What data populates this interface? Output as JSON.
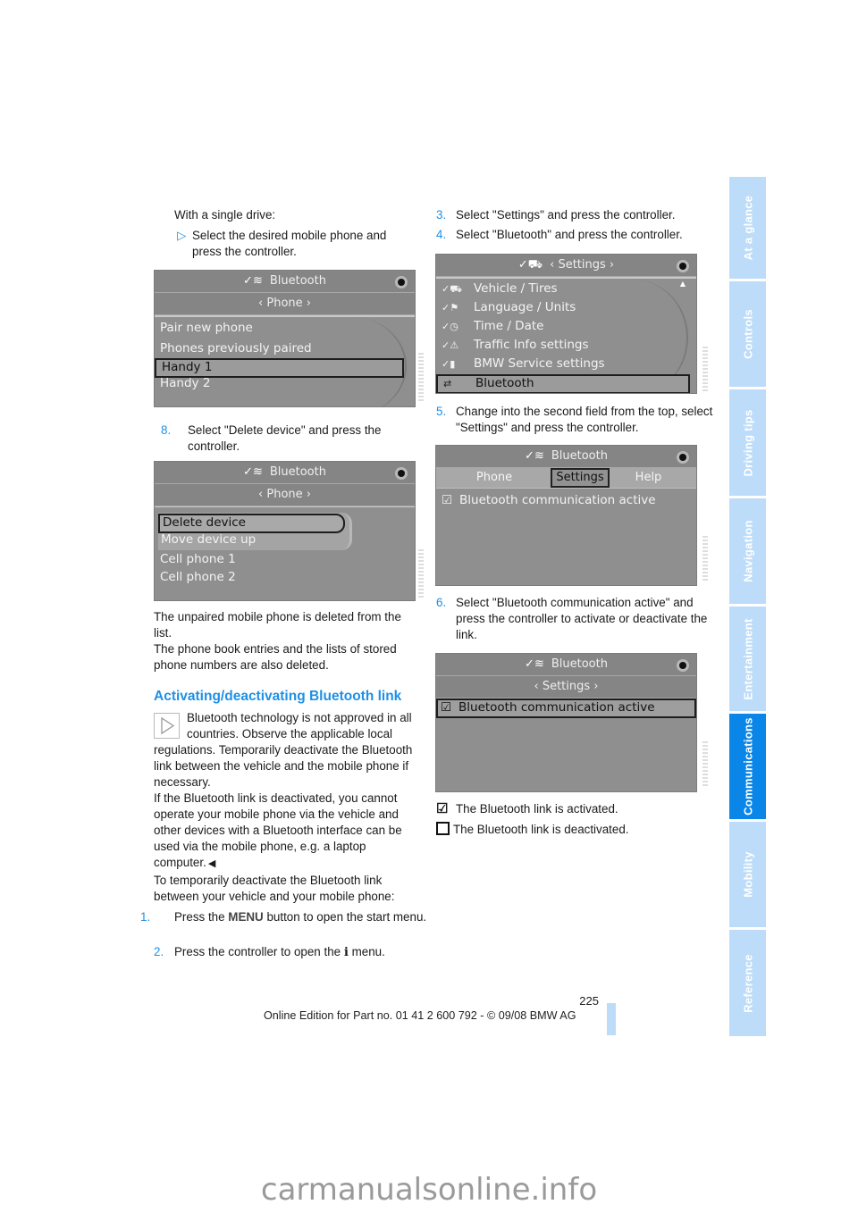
{
  "page_number": "225",
  "footer": "Online Edition for Part no. 01 41 2 600 792 - © 09/08 BMW AG",
  "watermark": "carmanualsonline.info",
  "colors": {
    "accent": "#1e90e6",
    "sidebar": "#bcdcf9",
    "sidebar_active": "#0a86e8",
    "screen_bg": "#8f8f8f"
  },
  "sidebar": {
    "tabs": [
      {
        "label": "At a glance",
        "active": false
      },
      {
        "label": "Controls",
        "active": false
      },
      {
        "label": "Driving tips",
        "active": false
      },
      {
        "label": "Navigation",
        "active": false
      },
      {
        "label": "Entertainment",
        "active": false
      },
      {
        "label": "Communications",
        "active": true
      },
      {
        "label": "Mobility",
        "active": false
      },
      {
        "label": "Reference",
        "active": false
      }
    ]
  },
  "left": {
    "intro": "With a single drive:",
    "bullet_marker": "▷",
    "bullet": "Select the desired mobile phone and press the controller.",
    "screen1": {
      "title_icon": "bluetooth-settings-icon",
      "title": "Bluetooth",
      "subtitle": "‹ Phone ›",
      "items": [
        "Pair new phone",
        "Phones previously paired",
        "Handy 1",
        "Handy 2"
      ],
      "selected_index": 2
    },
    "step8_num": "8.",
    "step8": "Select \"Delete device\" and press the controller.",
    "screen2": {
      "title": "Bluetooth",
      "subtitle": "‹ Phone ›",
      "popup_items": [
        "Delete device",
        "Move device up"
      ],
      "items": [
        "Cell phone 1",
        "Cell phone 2"
      ]
    },
    "para1": "The unpaired mobile phone is deleted from the list.",
    "para2": "The phone book entries and the lists of stored phone numbers are also deleted.",
    "heading": "Activating/deactivating Bluetooth link",
    "note": "Bluetooth technology is not approved in all countries. Observe the applicable local regulations. Temporarily deactivate the Bluetooth link between the vehicle and the mobile phone if necessary.",
    "note2": "If the Bluetooth link is deactivated, you cannot operate your mobile phone via the vehicle and other devices with a Bluetooth interface can be used via the mobile phone, e.g. a laptop computer.",
    "end_mark": "◀",
    "para3": "To temporarily deactivate the Bluetooth link between your vehicle and your mobile phone:",
    "step1_num": "1.",
    "step1_a": "Press the ",
    "step1_key": "MENU",
    "step1_b": " button to open the start menu.",
    "step2_num": "2.",
    "step2_a": "Press the controller to open the ",
    "step2_key": "i",
    "step2_b": " menu."
  },
  "right": {
    "step3_num": "3.",
    "step3": "Select \"Settings\" and press the controller.",
    "step4_num": "4.",
    "step4": "Select \"Bluetooth\" and press the controller.",
    "screen3": {
      "title": "‹ Settings ›",
      "items": [
        {
          "icon": "vehicle-icon",
          "label": "Vehicle / Tires"
        },
        {
          "icon": "language-icon",
          "label": "Language / Units"
        },
        {
          "icon": "clock-icon",
          "label": "Time / Date"
        },
        {
          "icon": "warning-icon",
          "label": "Traffic Info settings"
        },
        {
          "icon": "service-icon",
          "label": "BMW Service settings"
        },
        {
          "icon": "bluetooth-icon",
          "label": "Bluetooth"
        }
      ],
      "selected_index": 5
    },
    "step5_num": "5.",
    "step5": "Change into the second field from the top, select \"Settings\" and press the controller.",
    "screen4": {
      "title": "Bluetooth",
      "tabs": [
        "Phone",
        "Settings",
        "Help"
      ],
      "active_tab": 1,
      "option": "Bluetooth communication active",
      "checked": true
    },
    "step6_num": "6.",
    "step6": "Select \"Bluetooth communication active\" and press the controller to activate or deactivate the link.",
    "screen5": {
      "title": "Bluetooth",
      "subtitle": "‹ Settings ›",
      "option": "Bluetooth communication active",
      "checked": true
    },
    "legend_on": "The Bluetooth link is activated.",
    "legend_off": "The Bluetooth link is deactivated."
  }
}
